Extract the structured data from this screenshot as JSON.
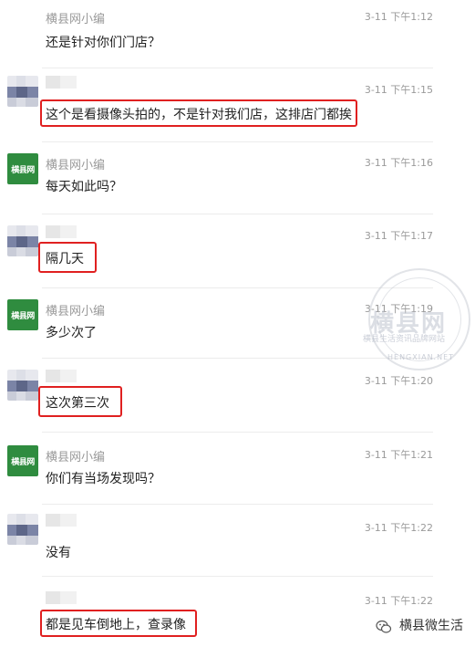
{
  "messages": [
    {
      "sender": "横县网小编",
      "time": "3-11 下午1:12",
      "text": "还是针对你们门店？",
      "highlight": false
    },
    {
      "sender": "",
      "time": "3-11 下午1:15",
      "text": "这个是看摄像头拍的，不是针对我们店，这排店门都挨",
      "highlight": true
    },
    {
      "sender": "横县网小编",
      "time": "3-11 下午1:16",
      "text": "每天如此吗？",
      "highlight": false
    },
    {
      "sender": "",
      "time": "3-11 下午1:17",
      "text": "隔几天",
      "highlight": true
    },
    {
      "sender": "横县网小编",
      "time": "3-11 下午1:19",
      "text": "多少次了",
      "highlight": false
    },
    {
      "sender": "",
      "time": "3-11 下午1:20",
      "text": "这次第三次",
      "highlight": true
    },
    {
      "sender": "横县网小编",
      "time": "3-11 下午1:21",
      "text": "你们有当场发现吗？",
      "highlight": false
    },
    {
      "sender": "",
      "time": "3-11 下午1:22",
      "text": "没有",
      "highlight": false
    },
    {
      "sender": "",
      "time": "3-11 下午1:22",
      "text": "都是见车倒地上，查录像",
      "highlight": true
    }
  ],
  "brand_avatar_text": "横县网",
  "watermark": {
    "title": "横县网",
    "subtitle": "横县生活资讯品牌网站",
    "bottom": "HENGXIAN.NET"
  },
  "footer": {
    "label": "横县微生活",
    "icon": "wechat-icon"
  },
  "colors": {
    "highlight": "#e02020",
    "brand": "#2f8c3f"
  }
}
